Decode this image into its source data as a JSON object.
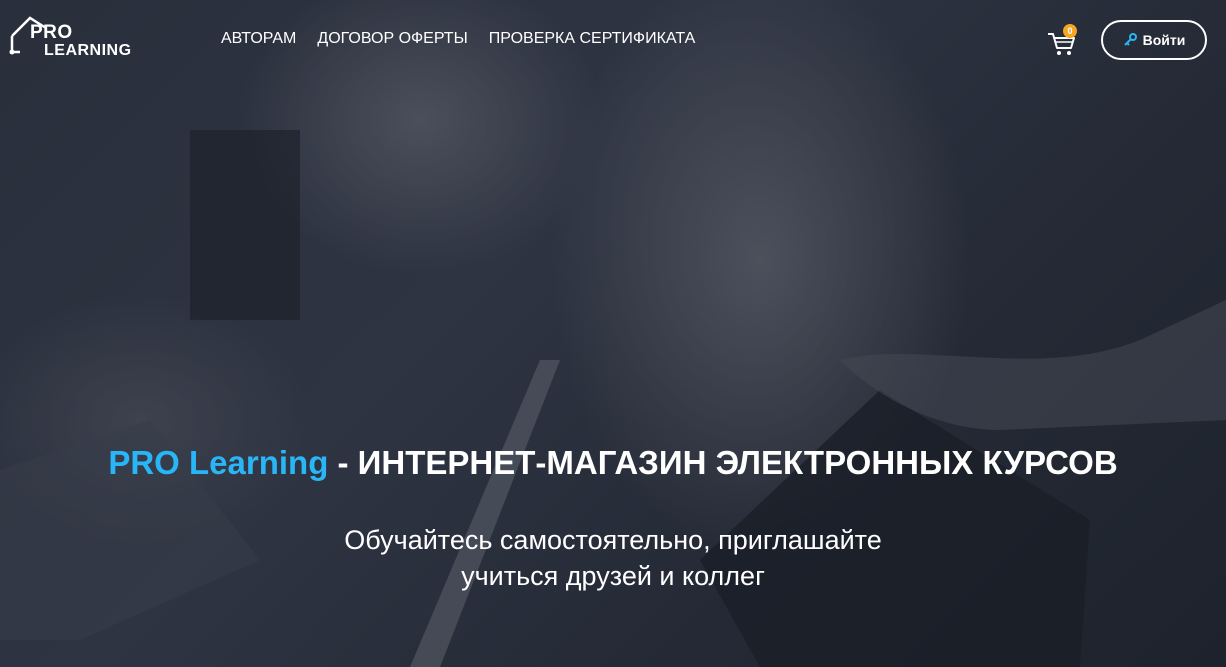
{
  "logo": {
    "line1": "PRO",
    "line2": "LEARNING"
  },
  "nav": {
    "items": [
      {
        "label": "АВТОРАМ"
      },
      {
        "label": "ДОГОВОР ОФЕРТЫ"
      },
      {
        "label": "ПРОВЕРКА СЕРТИФИКАТА"
      }
    ]
  },
  "cart": {
    "icon": "cart-icon",
    "count": "0"
  },
  "login": {
    "icon": "key-icon",
    "label": "Войти"
  },
  "hero": {
    "brand": "PRO Learning",
    "title_rest": " - ИНТЕРНЕТ-МАГАЗИН ЭЛЕКТРОННЫХ КУРСОВ",
    "subtitle_line1": "Обучайтесь самостоятельно, приглашайте",
    "subtitle_line2": "учиться друзей и коллег"
  },
  "colors": {
    "accent": "#29b6f6",
    "badge": "#f5a623",
    "overlay": "#1c2230"
  }
}
